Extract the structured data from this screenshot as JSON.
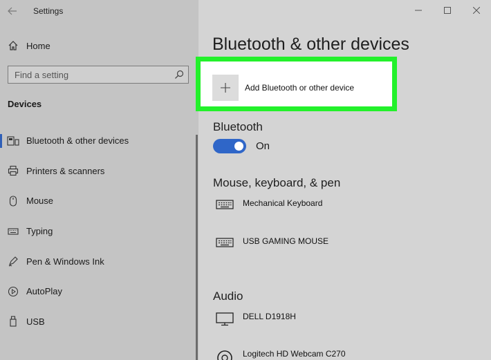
{
  "window": {
    "title": "Settings",
    "back_icon": "arrow-left-icon",
    "minimize_icon": "minimize-icon",
    "maximize_icon": "maximize-icon",
    "close_icon": "close-icon"
  },
  "sidebar": {
    "home_label": "Home",
    "search_placeholder": "Find a setting",
    "section_title": "Devices",
    "items": [
      {
        "label": "Bluetooth & other devices",
        "icon": "bluetooth-devices-icon",
        "active": true
      },
      {
        "label": "Printers & scanners",
        "icon": "printer-icon",
        "active": false
      },
      {
        "label": "Mouse",
        "icon": "mouse-icon",
        "active": false
      },
      {
        "label": "Typing",
        "icon": "keyboard-icon",
        "active": false
      },
      {
        "label": "Pen & Windows Ink",
        "icon": "pen-icon",
        "active": false
      },
      {
        "label": "AutoPlay",
        "icon": "autoplay-icon",
        "active": false
      },
      {
        "label": "USB",
        "icon": "usb-icon",
        "active": false
      }
    ]
  },
  "main": {
    "title": "Bluetooth & other devices",
    "add_device_label": "Add Bluetooth or other device",
    "highlight_color": "#23f12b",
    "bluetooth": {
      "heading": "Bluetooth",
      "state_label": "On",
      "on": true,
      "toggle_color": "#2f66c8"
    },
    "mouse_keyboard_pen": {
      "heading": "Mouse, keyboard, & pen",
      "devices": [
        {
          "name": "Mechanical Keyboard",
          "icon": "keyboard-icon"
        },
        {
          "name": "USB GAMING MOUSE",
          "icon": "keyboard-icon"
        }
      ]
    },
    "audio": {
      "heading": "Audio",
      "devices": [
        {
          "name": "DELL D1918H",
          "icon": "monitor-icon"
        },
        {
          "name": "Logitech HD Webcam C270",
          "icon": "webcam-icon"
        }
      ]
    }
  }
}
